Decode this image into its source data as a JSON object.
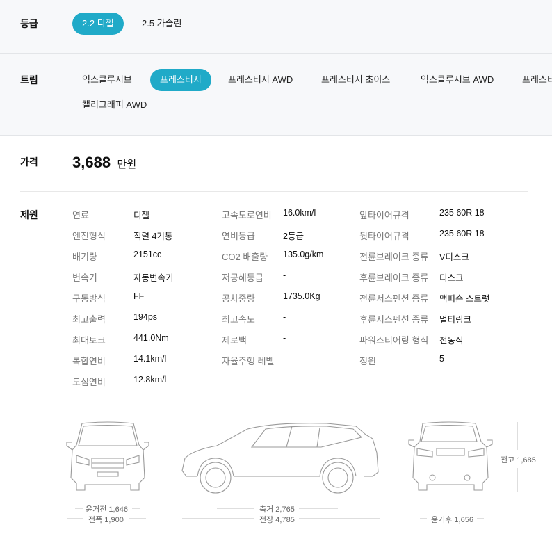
{
  "grade": {
    "label": "등급",
    "options": [
      "2.2 디젤",
      "2.5 가솔린"
    ],
    "selected": "2.2 디젤"
  },
  "trim": {
    "label": "트림",
    "options": [
      "익스클루시브",
      "프레스티지",
      "프레스티지 AWD",
      "프레스티지 초이스",
      "익스클루시브 AWD",
      "프레스티",
      "캘리그래피 AWD"
    ],
    "selected": "프레스티지"
  },
  "price": {
    "label": "가격",
    "value": "3,688",
    "unit": "만원"
  },
  "specs": {
    "label": "제원",
    "col1": [
      {
        "label": "연료",
        "value": "디젤"
      },
      {
        "label": "엔진형식",
        "value": "직렬 4기통"
      },
      {
        "label": "배기량",
        "value": "2151cc"
      },
      {
        "label": "변속기",
        "value": "자동변속기"
      },
      {
        "label": "구동방식",
        "value": "FF"
      },
      {
        "label": "최고출력",
        "value": "194ps"
      },
      {
        "label": "최대토크",
        "value": "441.0Nm"
      },
      {
        "label": "복합연비",
        "value": "14.1km/l"
      },
      {
        "label": "도심연비",
        "value": "12.8km/l"
      }
    ],
    "col2": [
      {
        "label": "고속도로연비",
        "value": "16.0km/l"
      },
      {
        "label": "연비등급",
        "value": "2등급"
      },
      {
        "label": "CO2 배출량",
        "value": "135.0g/km"
      },
      {
        "label": "저공해등급",
        "value": "-"
      },
      {
        "label": "공차중량",
        "value": "1735.0Kg"
      },
      {
        "label": "최고속도",
        "value": "-"
      },
      {
        "label": "제로백",
        "value": "-"
      },
      {
        "label": "자율주행 레벨",
        "value": "-"
      }
    ],
    "col3": [
      {
        "label": "앞타이어규격",
        "value": "235 60R 18"
      },
      {
        "label": "뒷타이어규격",
        "value": "235 60R 18"
      },
      {
        "label": "전륜브레이크 종류",
        "value": "V디스크"
      },
      {
        "label": "후륜브레이크 종류",
        "value": "디스크"
      },
      {
        "label": "전륜서스펜션 종류",
        "value": "맥퍼슨 스트럿"
      },
      {
        "label": "후륜서스펜션 종류",
        "value": "멀티링크"
      },
      {
        "label": "파워스티어링 형식",
        "value": "전동식"
      },
      {
        "label": "정원",
        "value": "5"
      }
    ]
  },
  "dimensions": {
    "front_tread": "윤거전 1,646",
    "width": "전폭 1,900",
    "wheelbase": "축거 2,765",
    "length": "전장 4,785",
    "height": "전고 1,685",
    "rear_tread": "윤거후 1,656"
  }
}
